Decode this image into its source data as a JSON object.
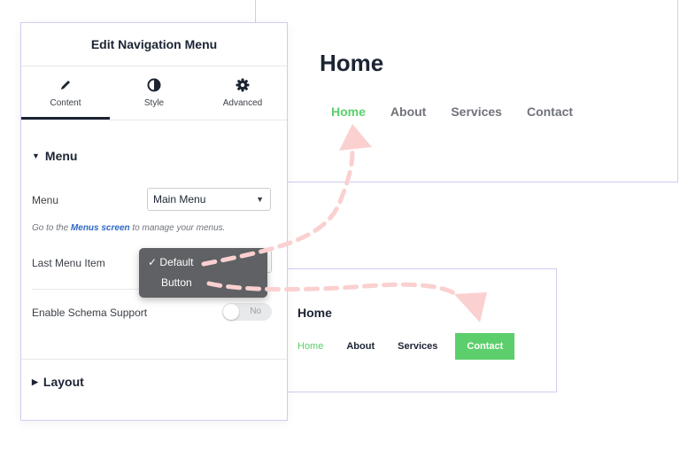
{
  "preview_top": {
    "title": "Home",
    "nav": [
      "Home",
      "About",
      "Services",
      "Contact"
    ]
  },
  "preview_bottom": {
    "title": "Home",
    "nav": [
      "Home",
      "About",
      "Services"
    ],
    "button": "Contact"
  },
  "panel": {
    "title": "Edit Navigation Menu",
    "tabs": [
      {
        "label": "Content",
        "icon": "pencil-icon"
      },
      {
        "label": "Style",
        "icon": "contrast-icon"
      },
      {
        "label": "Advanced",
        "icon": "gear-icon"
      }
    ],
    "menu_section": "Menu",
    "menu_label": "Menu",
    "menu_value": "Main Menu",
    "help_prefix": "Go to the ",
    "help_link": "Menus screen",
    "help_suffix": " to manage your menus.",
    "last_item_label": "Last Menu Item",
    "dropdown_options": [
      "Default",
      "Button"
    ],
    "dropdown_checkmark": "✓",
    "schema_label": "Enable Schema Support",
    "schema_toggle": "No",
    "layout_section": "Layout"
  },
  "colors": {
    "accent_green": "#5ccf6c",
    "link_blue": "#2f68c6",
    "arrow_pink": "#fbd0d0"
  }
}
